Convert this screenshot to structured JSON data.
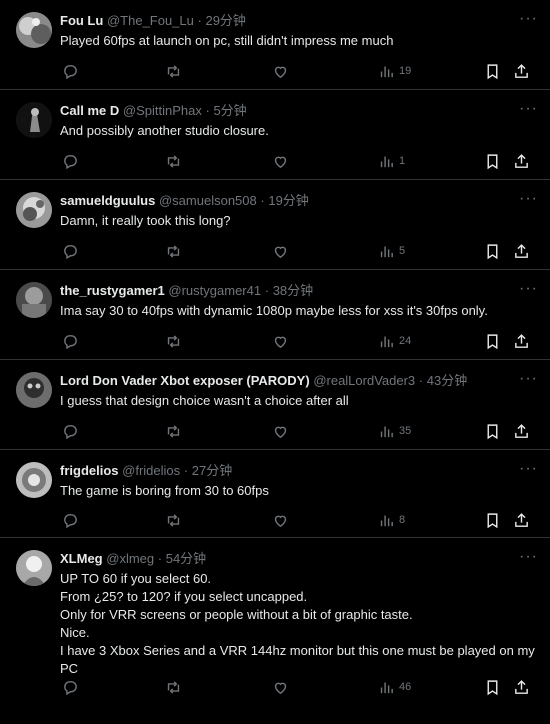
{
  "replies": [
    {
      "name": "Fou Lu",
      "handle": "@The_Fou_Lu",
      "time": "29分钟",
      "text": "Played 60fps at launch on pc, still didn't impress me much",
      "views": "19"
    },
    {
      "name": "Call me D",
      "handle": "@SpittinPhax",
      "time": "5分钟",
      "text": "And possibly another studio closure.",
      "views": "1"
    },
    {
      "name": "samueldguulus",
      "handle": "@samuelson508",
      "time": "19分钟",
      "text": "Damn, it really took this long?",
      "views": "5"
    },
    {
      "name": "the_rustygamer1",
      "handle": "@rustygamer41",
      "time": "38分钟",
      "text": "Ima say 30 to 40fps with dynamic 1080p maybe less for xss it's 30fps only.",
      "views": "24"
    },
    {
      "name": "Lord Don Vader Xbot exposer (PARODY)",
      "handle": "@realLordVader3",
      "time": "43分钟",
      "text": "I guess that design choice wasn't a choice after all",
      "views": "35"
    },
    {
      "name": "frigdelios",
      "handle": "@fridelios",
      "time": "27分钟",
      "text": "The game is boring from 30 to 60fps",
      "views": "8"
    },
    {
      "name": "XLMeg",
      "handle": "@xlmeg",
      "time": "54分钟",
      "text": "UP TO 60 if you select 60.\nFrom ¿25? to 120? if you select uncapped.\nOnly for VRR screens or people without a bit of graphic taste.\nNice.\nI have 3 Xbox Series and a VRR 144hz monitor but this one must be played on my PC",
      "views": "46"
    }
  ],
  "separator": "·",
  "more_label": "···",
  "icons": [
    "reply-icon",
    "retweet-icon",
    "like-icon",
    "views-icon",
    "bookmark-icon",
    "share-icon"
  ],
  "colors": {
    "background": "#000000",
    "text": "#e7e9ea",
    "muted": "#71767b",
    "divider": "#2f3336"
  }
}
